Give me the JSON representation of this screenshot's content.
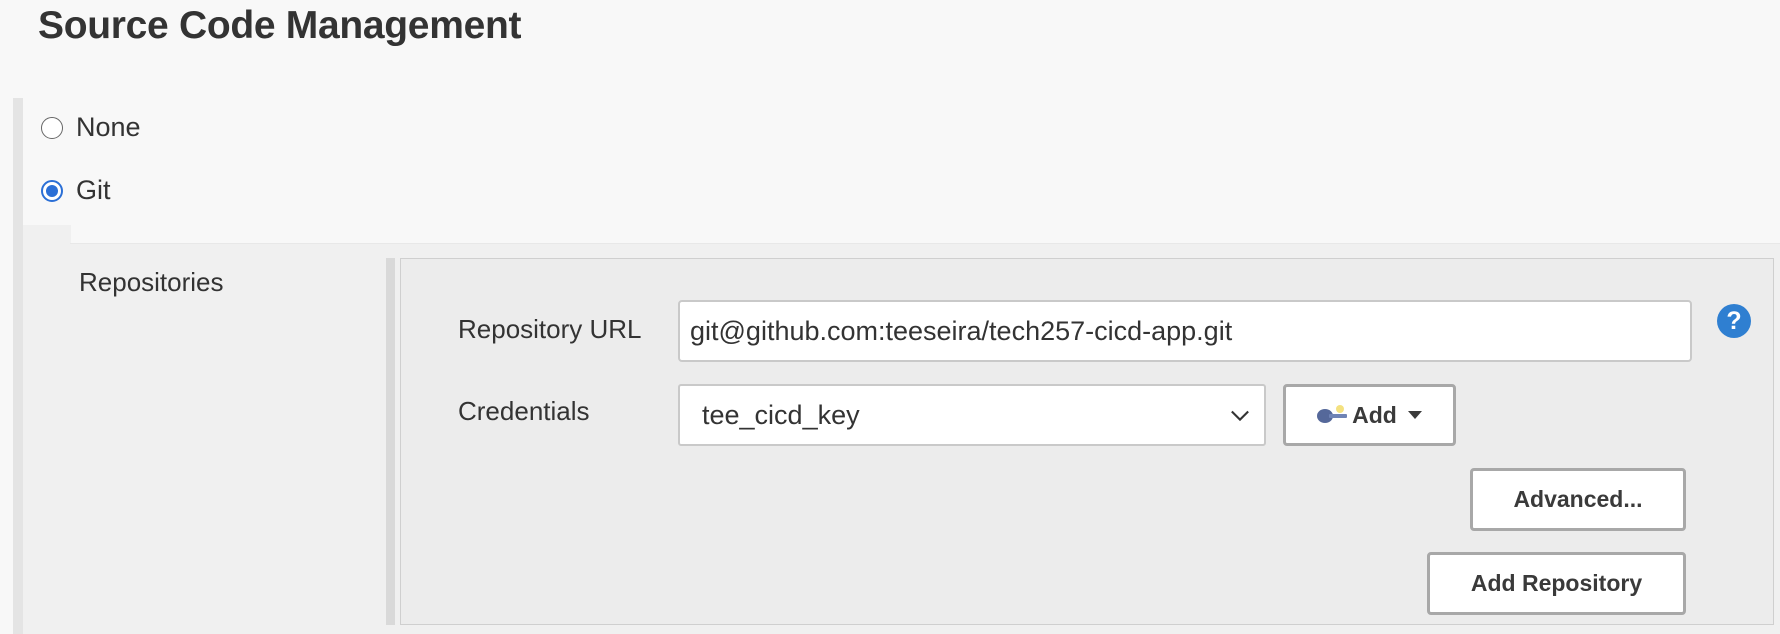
{
  "section": {
    "title": "Source Code Management"
  },
  "scm_options": [
    {
      "label": "None",
      "selected": false
    },
    {
      "label": "Git",
      "selected": true
    }
  ],
  "git": {
    "repositories_label": "Repositories",
    "repository_url_label": "Repository URL",
    "repository_url_value": "git@github.com:teeseira/tech257-cicd-app.git",
    "credentials_label": "Credentials",
    "credentials_value": "tee_cicd_key",
    "add_credentials_label": "Add",
    "advanced_label": "Advanced...",
    "add_repository_label": "Add Repository",
    "help_glyph": "?"
  },
  "colors": {
    "accent": "#2b6fd6",
    "help_icon": "#2f7fd1",
    "panel_bg": "#ececec",
    "page_bg": "#f8f8f8"
  },
  "icons": {
    "help": "help-icon",
    "key": "key-icon",
    "caret": "caret-down-icon",
    "chevron": "chevron-down-icon"
  }
}
